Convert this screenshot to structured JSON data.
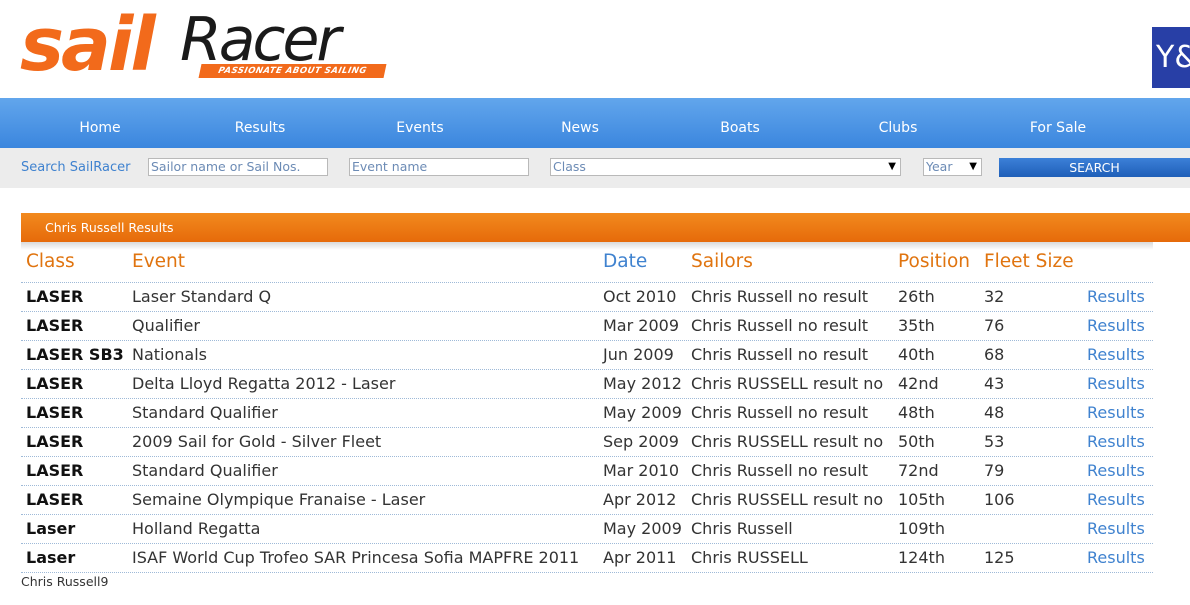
{
  "logo": {
    "sail": "sail",
    "racer": "Racer",
    "tagline": "PASSIONATE ABOUT SAILING"
  },
  "sponsor": {
    "text": "Y&"
  },
  "nav": [
    "Home",
    "Results",
    "Events",
    "News",
    "Boats",
    "Clubs",
    "For Sale"
  ],
  "search": {
    "label": "Search SailRacer",
    "sailor_placeholder": "Sailor name or Sail Nos.",
    "event_placeholder": "Event name",
    "class_value": "Class",
    "year_value": "Year",
    "button": "SEARCH"
  },
  "results": {
    "title": "Chris Russell Results",
    "columns": {
      "class": "Class",
      "event": "Event",
      "date": "Date",
      "sailors": "Sailors",
      "position": "Position",
      "fleet": "Fleet Size"
    },
    "rows": [
      {
        "class": "LASER",
        "event": "Laser Standard Q",
        "date": "Oct 2010",
        "sailors": "Chris Russell no result",
        "position": "26th",
        "fleet": "32",
        "link": "Results"
      },
      {
        "class": "LASER",
        "event": "Qualifier",
        "date": "Mar 2009",
        "sailors": "Chris Russell no result",
        "position": "35th",
        "fleet": "76",
        "link": "Results"
      },
      {
        "class": "LASER SB3",
        "event": "Nationals",
        "date": "Jun 2009",
        "sailors": "Chris Russell no result",
        "position": "40th",
        "fleet": "68",
        "link": "Results"
      },
      {
        "class": "LASER",
        "event": "Delta Lloyd Regatta 2012 - Laser",
        "date": "May 2012",
        "sailors": "Chris RUSSELL result no",
        "position": "42nd",
        "fleet": "43",
        "link": "Results"
      },
      {
        "class": "LASER",
        "event": "Standard Qualifier",
        "date": "May 2009",
        "sailors": "Chris Russell no result",
        "position": "48th",
        "fleet": "48",
        "link": "Results"
      },
      {
        "class": "LASER",
        "event": "2009 Sail for Gold - Silver Fleet",
        "date": "Sep 2009",
        "sailors": "Chris RUSSELL result no",
        "position": "50th",
        "fleet": "53",
        "link": "Results"
      },
      {
        "class": "LASER",
        "event": "Standard Qualifier",
        "date": "Mar 2010",
        "sailors": "Chris Russell no result",
        "position": "72nd",
        "fleet": "79",
        "link": "Results"
      },
      {
        "class": "LASER",
        "event": "Semaine Olympique Franaise - Laser",
        "date": "Apr 2012",
        "sailors": "Chris RUSSELL result no",
        "position": "105th",
        "fleet": "106",
        "link": "Results"
      },
      {
        "class": "Laser",
        "event": "Holland Regatta",
        "date": "May 2009",
        "sailors": "Chris Russell",
        "position": "109th",
        "fleet": "",
        "link": "Results"
      },
      {
        "class": "Laser",
        "event": "ISAF World Cup Trofeo SAR Princesa Sofia MAPFRE 2011",
        "date": "Apr 2011",
        "sailors": "Chris RUSSELL",
        "position": "124th",
        "fleet": "125",
        "link": "Results"
      }
    ]
  },
  "footer": "Chris Russell9"
}
